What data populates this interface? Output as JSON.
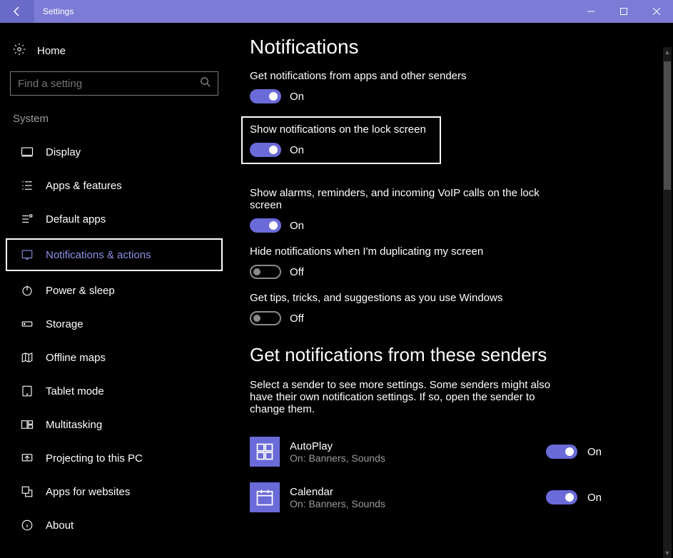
{
  "titlebar": {
    "title": "Settings"
  },
  "sidebar": {
    "home": "Home",
    "search_placeholder": "Find a setting",
    "section": "System",
    "items": [
      {
        "label": "Display",
        "icon": "display-icon"
      },
      {
        "label": "Apps & features",
        "icon": "apps-icon"
      },
      {
        "label": "Default apps",
        "icon": "default-apps-icon"
      },
      {
        "label": "Notifications & actions",
        "icon": "notifications-icon",
        "active": true
      },
      {
        "label": "Power & sleep",
        "icon": "power-icon"
      },
      {
        "label": "Storage",
        "icon": "storage-icon"
      },
      {
        "label": "Offline maps",
        "icon": "maps-icon"
      },
      {
        "label": "Tablet mode",
        "icon": "tablet-icon"
      },
      {
        "label": "Multitasking",
        "icon": "multitasking-icon"
      },
      {
        "label": "Projecting to this PC",
        "icon": "projecting-icon"
      },
      {
        "label": "Apps for websites",
        "icon": "apps-websites-icon"
      },
      {
        "label": "About",
        "icon": "about-icon"
      }
    ]
  },
  "main": {
    "heading1": "Notifications",
    "settings": [
      {
        "label": "Get notifications from apps and other senders",
        "state": "On",
        "on": true
      },
      {
        "label": "Show notifications on the lock screen",
        "state": "On",
        "on": true,
        "highlighted": true
      },
      {
        "label": "Show alarms, reminders, and incoming VoIP calls on the lock screen",
        "state": "On",
        "on": true
      },
      {
        "label": "Hide notifications when I'm duplicating my screen",
        "state": "Off",
        "on": false
      },
      {
        "label": "Get tips, tricks, and suggestions as you use Windows",
        "state": "Off",
        "on": false
      }
    ],
    "heading2": "Get notifications from these senders",
    "senders_desc": "Select a sender to see more settings. Some senders might also have their own notification settings. If so, open the sender to change them.",
    "senders": [
      {
        "name": "AutoPlay",
        "sub": "On: Banners, Sounds",
        "state": "On",
        "on": true,
        "icon": "autoplay-icon"
      },
      {
        "name": "Calendar",
        "sub": "On: Banners, Sounds",
        "state": "On",
        "on": true,
        "icon": "calendar-icon"
      }
    ]
  }
}
